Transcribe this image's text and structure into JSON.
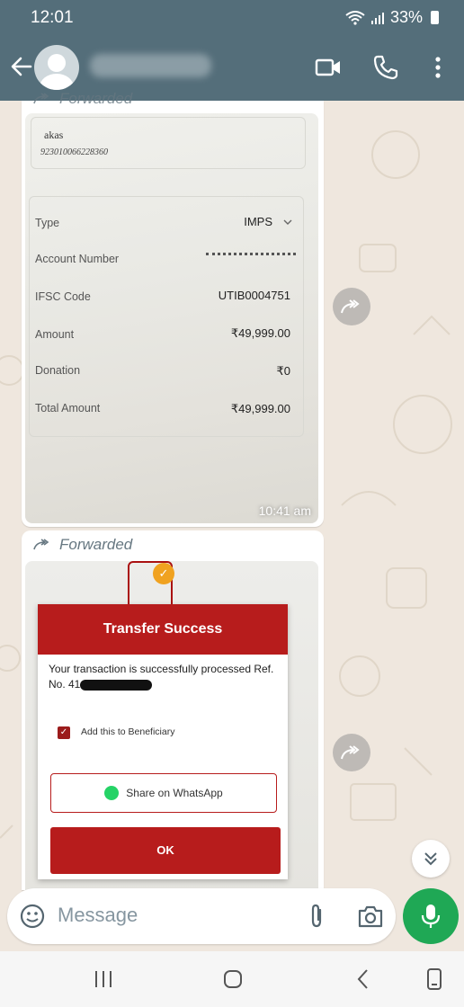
{
  "status_bar": {
    "time": "12:01",
    "battery": "33%"
  },
  "header": {
    "contact_name": "",
    "colors": {
      "bar": "#546e7a"
    }
  },
  "messages": [
    {
      "forwarded_label": "Forwarded",
      "account_name": "akas",
      "account_number": "923010066228360",
      "rows": [
        {
          "label": "Type",
          "value": "IMPS"
        },
        {
          "label": "Account Number",
          "value": ""
        },
        {
          "label": "IFSC Code",
          "value": "UTIB0004751"
        },
        {
          "label": "Amount",
          "value": "₹49,999.00"
        },
        {
          "label": "Donation",
          "value": "₹0"
        },
        {
          "label": "Total Amount",
          "value": "₹49,999.00"
        }
      ],
      "timestamp": "10:41 am"
    },
    {
      "forwarded_label": "Forwarded",
      "dialog_title": "Transfer Success",
      "dialog_message": "Your transaction is successfully processed Ref. No. 41",
      "checkbox_label": "Add this to Beneficiary",
      "share_label": "Share on WhatsApp",
      "ok_label": "OK"
    }
  ],
  "composer": {
    "placeholder": "Message"
  },
  "icons": {
    "back": "arrow-left-icon",
    "video": "video-call-icon",
    "call": "phone-icon",
    "menu": "more-vert-icon",
    "forward": "forward-icon",
    "scroll": "double-chevron-down-icon",
    "emoji": "emoji-icon",
    "attach": "paperclip-icon",
    "camera": "camera-icon",
    "mic": "mic-icon"
  },
  "colors": {
    "accent": "#1fa855",
    "dialog_red": "#b71c1c",
    "chat_bg": "#efe7de"
  }
}
